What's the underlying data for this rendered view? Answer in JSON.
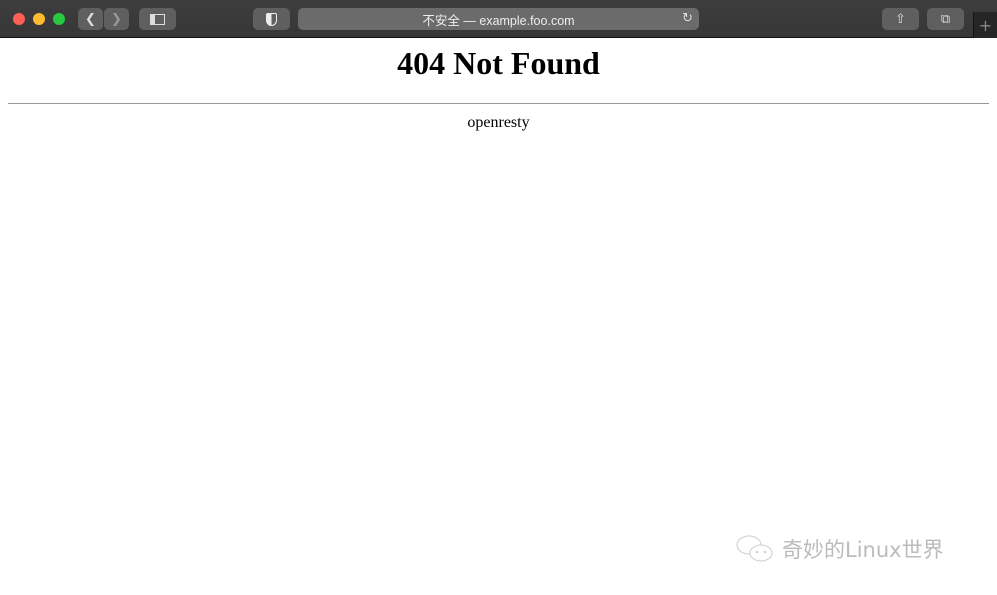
{
  "browser": {
    "url_display": "不安全 — example.foo.com",
    "colors": {
      "close": "#fe5f57",
      "minimize": "#febc2e",
      "zoom": "#28c840"
    },
    "icons": [
      "back-icon",
      "forward-icon",
      "sidebar-icon",
      "shield-icon",
      "reload-icon",
      "share-icon",
      "tabs-icon",
      "new-tab-icon"
    ]
  },
  "page": {
    "title": "404 Not Found",
    "server": "openresty"
  },
  "watermark": {
    "text": "奇妙的Linux世界"
  }
}
